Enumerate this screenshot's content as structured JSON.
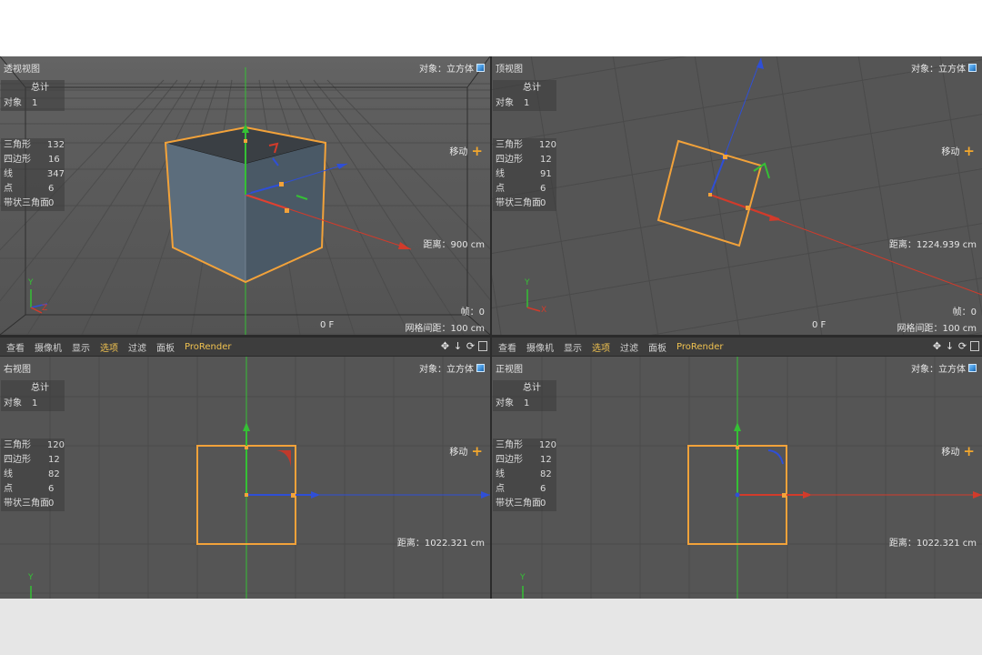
{
  "viewports": [
    {
      "id": "perspective",
      "title": "透视视图",
      "object_label": "对象：立方体",
      "move_label": "移动",
      "distance": "距离：900 cm",
      "frame": "帧：0",
      "grid_spacing": "网格间距：100 cm",
      "frame_f": "0 F",
      "stats": {
        "total_label": "总计",
        "object_key": "对象",
        "object_val": "1",
        "rows": [
          {
            "k": "三角形",
            "v": "132"
          },
          {
            "k": "四边形",
            "v": "16"
          },
          {
            "k": "线",
            "v": "347"
          },
          {
            "k": "点",
            "v": "6"
          },
          {
            "k": "带状三角面",
            "v": "0"
          }
        ]
      },
      "axis_labels": {
        "y": "Y",
        "z": "Z"
      }
    },
    {
      "id": "top",
      "title": "顶视图",
      "object_label": "对象：立方体",
      "move_label": "移动",
      "distance": "距离：1224.939 cm",
      "frame": "帧：0",
      "grid_spacing": "网格间距：100 cm",
      "frame_f": "0 F",
      "stats": {
        "total_label": "总计",
        "object_key": "对象",
        "object_val": "1",
        "rows": [
          {
            "k": "三角形",
            "v": "120"
          },
          {
            "k": "四边形",
            "v": "12"
          },
          {
            "k": "线",
            "v": "91"
          },
          {
            "k": "点",
            "v": "6"
          },
          {
            "k": "带状三角面",
            "v": "0"
          }
        ]
      },
      "axis_labels": {
        "y": "Y",
        "x": "X"
      }
    },
    {
      "id": "right",
      "title": "右视图",
      "object_label": "对象：立方体",
      "move_label": "移动",
      "distance": "距离：1022.321 cm",
      "stats": {
        "total_label": "总计",
        "object_key": "对象",
        "object_val": "1",
        "rows": [
          {
            "k": "三角形",
            "v": "120"
          },
          {
            "k": "四边形",
            "v": "12"
          },
          {
            "k": "线",
            "v": "82"
          },
          {
            "k": "点",
            "v": "6"
          },
          {
            "k": "带状三角面",
            "v": "0"
          }
        ]
      },
      "axis_labels": {
        "y": "Y"
      }
    },
    {
      "id": "front",
      "title": "正视图",
      "object_label": "对象：立方体",
      "move_label": "移动",
      "distance": "距离：1022.321 cm",
      "stats": {
        "total_label": "总计",
        "object_key": "对象",
        "object_val": "1",
        "rows": [
          {
            "k": "三角形",
            "v": "120"
          },
          {
            "k": "四边形",
            "v": "12"
          },
          {
            "k": "线",
            "v": "82"
          },
          {
            "k": "点",
            "v": "6"
          },
          {
            "k": "带状三角面",
            "v": "0"
          }
        ]
      },
      "axis_labels": {
        "y": "Y"
      }
    }
  ],
  "menubar": {
    "items": [
      "查看",
      "摄像机",
      "显示",
      "选项",
      "过滤",
      "面板",
      "ProRender"
    ],
    "active_item": "选项"
  },
  "colors": {
    "x_axis": "#d23b2b",
    "y_axis": "#35c035",
    "z_axis": "#2f4fd6",
    "selection": "#f2a23a",
    "viewport_bg": "#535353",
    "accent": "#f0c250"
  }
}
